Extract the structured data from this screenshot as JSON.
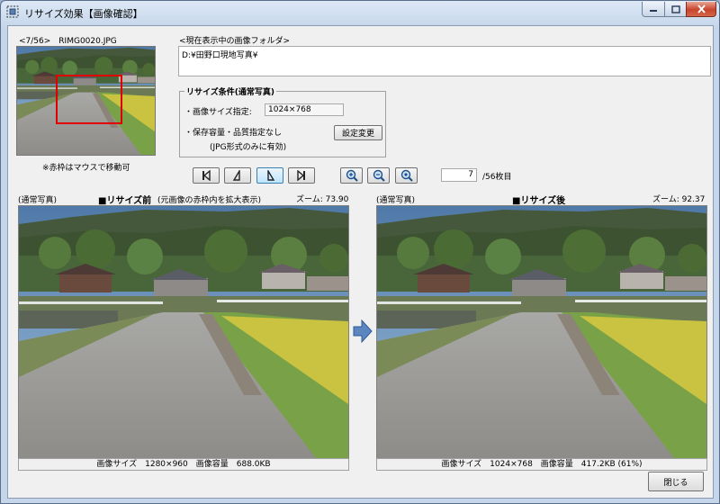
{
  "window": {
    "title": "リサイズ効果【画像確認】",
    "icons": {
      "app": "resize-app-icon",
      "minimize": "minimize-icon",
      "maximize": "maximize-icon",
      "close": "close-icon"
    },
    "colors": {
      "frame": "#c6d6ea",
      "close_button": "#c7442c",
      "selection_box": "#e00000",
      "client": "#f0f0f0"
    }
  },
  "thumbnail": {
    "file_label": "<7/56>　RIMG0020.JPG",
    "note": "※赤枠はマウスで移動可",
    "selection_box_color": "#e00000"
  },
  "folder": {
    "label": "<現在表示中の画像フォルダ>",
    "path": "D:¥田野口現地写真¥"
  },
  "conditions": {
    "group_title": "リサイズ条件(通常写真)",
    "size_label": "・画像サイズ指定:",
    "size_value": "1024×768",
    "quality_label": "・保存容量・品質指定なし",
    "jpg_note": "(JPG形式のみに有効)",
    "change_button": "設定変更"
  },
  "navigation": {
    "first_icon": "skip-first-icon",
    "prev_icon": "step-prev-icon",
    "next_icon": "step-next-icon",
    "last_icon": "skip-last-icon",
    "zoom_in_icon": "zoom-in-icon",
    "zoom_out_icon": "zoom-out-icon",
    "zoom_fit_icon": "zoom-fit-icon",
    "page_value": "7",
    "page_suffix": "/56枚目"
  },
  "before": {
    "mode": "(通常写真)",
    "title": "■リサイズ前",
    "subtitle": "(元画像の赤枠内を拡大表示)",
    "zoom_text": "ズーム: 73.90",
    "status": "画像サイズ　1280×960　画像容量　688.0KB"
  },
  "after": {
    "mode": "(通常写真)",
    "title": "■リサイズ後",
    "zoom_text": "ズーム: 92.37",
    "status": "画像サイズ　1024×768　画像容量　417.2KB (61%)"
  },
  "arrow_icon": "arrow-right-icon",
  "close_button": "閉じる"
}
